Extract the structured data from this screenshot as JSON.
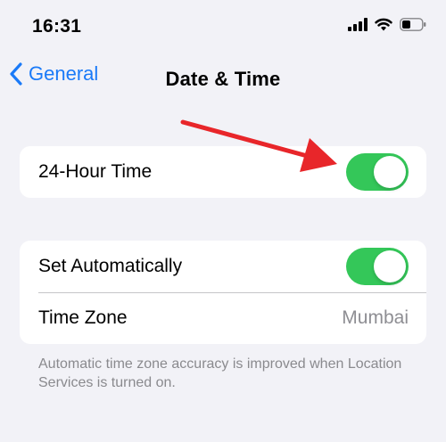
{
  "status_bar": {
    "time": "16:31"
  },
  "nav": {
    "back_label": "General",
    "title": "Date & Time"
  },
  "settings": {
    "hour24": {
      "label": "24-Hour Time",
      "enabled": true
    },
    "auto": {
      "label": "Set Automatically",
      "enabled": true
    },
    "timezone": {
      "label": "Time Zone",
      "value": "Mumbai"
    }
  },
  "footer_note": "Automatic time zone accuracy is improved when Location Services is turned on.",
  "colors": {
    "accent": "#1a7af8",
    "toggle_on": "#34c759",
    "annotation_arrow": "#e8262a"
  },
  "icons": [
    "signal-bars-icon",
    "wifi-icon",
    "battery-icon",
    "chevron-left-icon"
  ]
}
